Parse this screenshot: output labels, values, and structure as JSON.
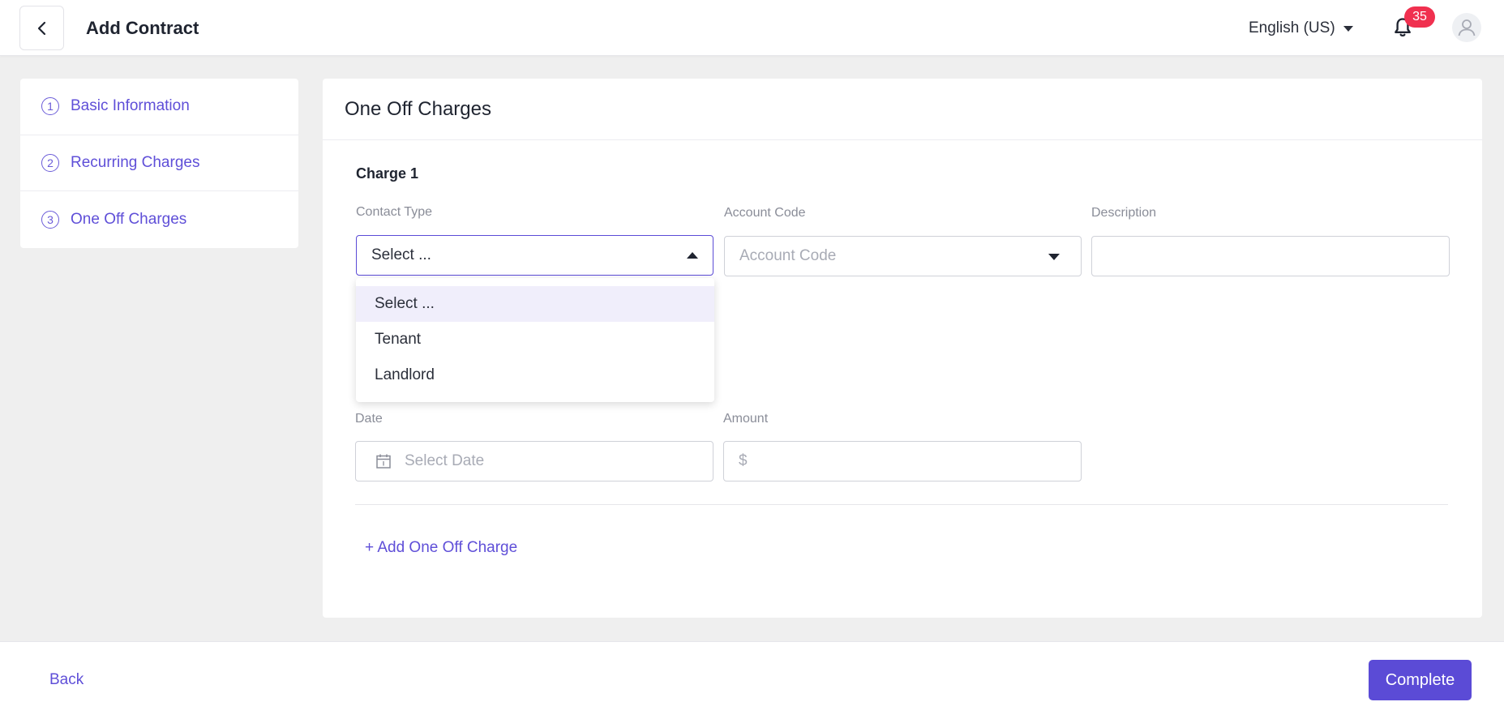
{
  "header": {
    "title": "Add Contract",
    "language": "English (US)",
    "notification_count": "35"
  },
  "steps": [
    {
      "number": "1",
      "label": "Basic Information"
    },
    {
      "number": "2",
      "label": "Recurring Charges"
    },
    {
      "number": "3",
      "label": "One Off Charges"
    }
  ],
  "main": {
    "title": "One Off Charges",
    "charge_label": "Charge 1",
    "contact_type": {
      "label": "Contact Type",
      "value": "Select ..."
    },
    "account_code": {
      "label": "Account Code",
      "placeholder": "Account Code"
    },
    "description": {
      "label": "Description",
      "value": ""
    },
    "date": {
      "label": "Date",
      "placeholder": "Select Date"
    },
    "amount": {
      "label": "Amount",
      "prefix": "$"
    },
    "add_link": "+ Add One Off Charge"
  },
  "dropdown": {
    "options": [
      "Select ...",
      "Tenant",
      "Landlord"
    ],
    "highlighted": "Select ..."
  },
  "footer": {
    "back_label": "Back",
    "complete_label": "Complete"
  },
  "colors": {
    "accent": "#5b4bd6",
    "badge": "#f0304f"
  }
}
